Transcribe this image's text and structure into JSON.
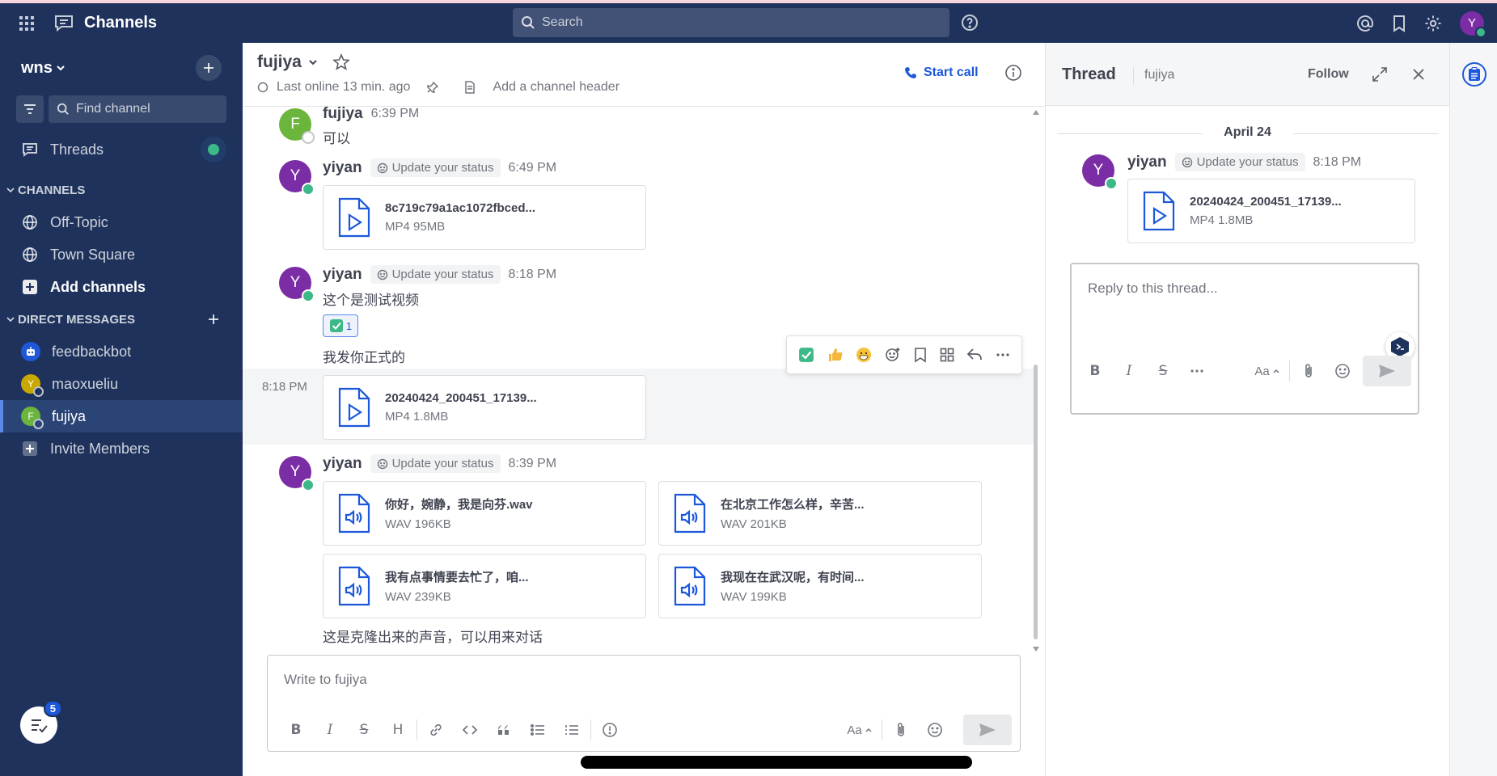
{
  "topbar": {
    "app_title": "Channels",
    "search_placeholder": "Search",
    "user_initial": "Y"
  },
  "sidebar": {
    "team_name": "wns",
    "find_channel": "Find channel",
    "threads_label": "Threads",
    "channels_header": "CHANNELS",
    "channels": [
      {
        "label": "Off-Topic"
      },
      {
        "label": "Town Square"
      }
    ],
    "add_channels": "Add channels",
    "dm_header": "DIRECT MESSAGES",
    "dms": [
      {
        "label": "feedbackbot",
        "initial": "",
        "color": "#1c58d9"
      },
      {
        "label": "maoxueliu",
        "initial": "Y",
        "color": "#c9a900"
      },
      {
        "label": "fujiya",
        "initial": "F",
        "color": "#6bb53d"
      }
    ],
    "invite": "Invite Members",
    "badge_count": "5"
  },
  "channel": {
    "name": "fujiya",
    "last_online": "Last online 13 min. ago",
    "add_header": "Add a channel header",
    "start_call": "Start call"
  },
  "messages": {
    "m1": {
      "user": "fujiya",
      "initial": "F",
      "time": "6:39 PM",
      "text": "可以"
    },
    "m2": {
      "user": "yiyan",
      "initial": "Y",
      "status": "Update your status",
      "time": "6:49 PM",
      "file": {
        "name": "8c719c79a1ac1072fbced...",
        "meta": "MP4 95MB"
      }
    },
    "m3": {
      "user": "yiyan",
      "initial": "Y",
      "status": "Update your status",
      "time": "8:18 PM",
      "text": "这个是测试视频",
      "reaction_count": "1",
      "text2": "我发你正式的"
    },
    "m4": {
      "time": "8:18 PM",
      "file": {
        "name": "20240424_200451_17139...",
        "meta": "MP4 1.8MB"
      }
    },
    "m5": {
      "user": "yiyan",
      "initial": "Y",
      "status": "Update your status",
      "time": "8:39 PM",
      "files": [
        {
          "name": "你好，婉静，我是向芬.wav",
          "meta": "WAV 196KB"
        },
        {
          "name": "在北京工作怎么样，辛苦...",
          "meta": "WAV 201KB"
        },
        {
          "name": "我有点事情要去忙了，咱...",
          "meta": "WAV 239KB"
        },
        {
          "name": "我现在在武汉呢，有时间...",
          "meta": "WAV 199KB"
        }
      ],
      "text": "这是克隆出来的声音，可以用来对话"
    }
  },
  "composer": {
    "placeholder": "Write to fujiya",
    "font_label": "Aa"
  },
  "thread": {
    "title": "Thread",
    "channel": "fujiya",
    "follow": "Follow",
    "date": "April 24",
    "user": "yiyan",
    "initial": "Y",
    "status": "Update your status",
    "time": "8:18 PM",
    "file": {
      "name": "20240424_200451_17139...",
      "meta": "MP4 1.8MB"
    },
    "reply_placeholder": "Reply to this thread...",
    "font_label": "Aa"
  }
}
